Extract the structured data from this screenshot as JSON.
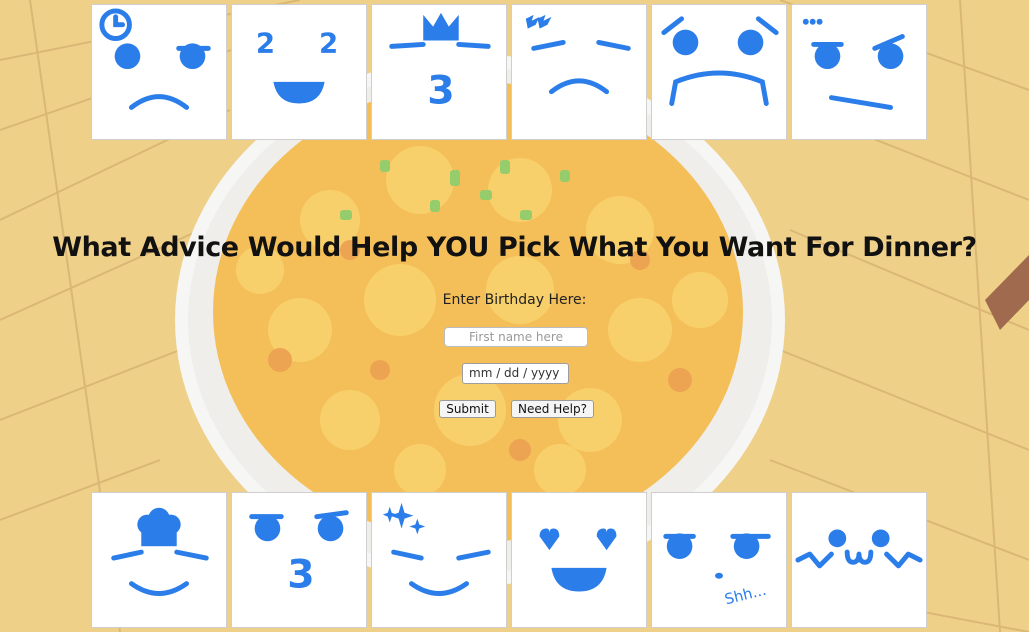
{
  "page": {
    "title": "What Advice Would Help YOU Pick What You Want For Dinner?"
  },
  "form": {
    "label": "Enter Birthday Here:",
    "name_placeholder": "First name here",
    "date_placeholder": "mm / dd / yyyy",
    "submit_label": "Submit",
    "help_label": "Need Help?"
  },
  "faces": {
    "top": [
      "clock-sad-face",
      "two-two-happy-face",
      "crown-three-face",
      "tired-frown-face",
      "worried-frown-face",
      "dots-skeptical-face"
    ],
    "bottom": [
      "chef-smile-face",
      "three-mouth-face",
      "sparkle-smile-face",
      "heart-eyes-face",
      "shh-face",
      "owo-face"
    ],
    "bottom_text": {
      "shh": "Shh..."
    }
  },
  "colors": {
    "face_blue": "#2b7de9",
    "background": "#e9c268",
    "tile_bg": "#ffffff"
  }
}
